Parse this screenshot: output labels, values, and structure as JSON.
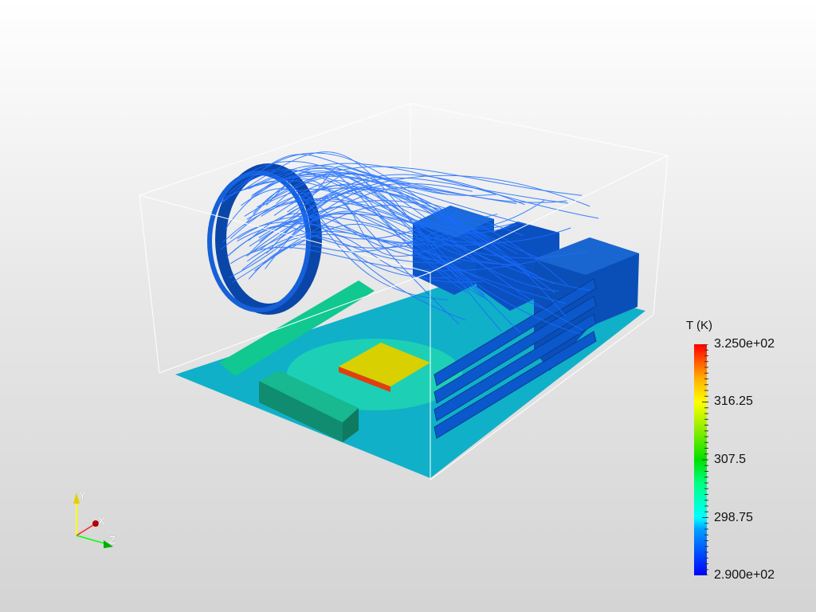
{
  "colorbar": {
    "title": "T (K)",
    "labels": [
      "3.250e+02",
      "316.25",
      "307.5",
      "298.75",
      "2.900e+02"
    ],
    "range": [
      290,
      325
    ],
    "colormap_colors": [
      "#0000ff",
      "#00ffff",
      "#00e000",
      "#ffff00",
      "#ff0000"
    ]
  },
  "axes": {
    "x": "X",
    "y": "Y",
    "z": "Z"
  },
  "colors": {
    "streamline": "#1a6cff",
    "component": "#0b55c8",
    "board": "#00c8b4",
    "chip": "#e0d000"
  }
}
